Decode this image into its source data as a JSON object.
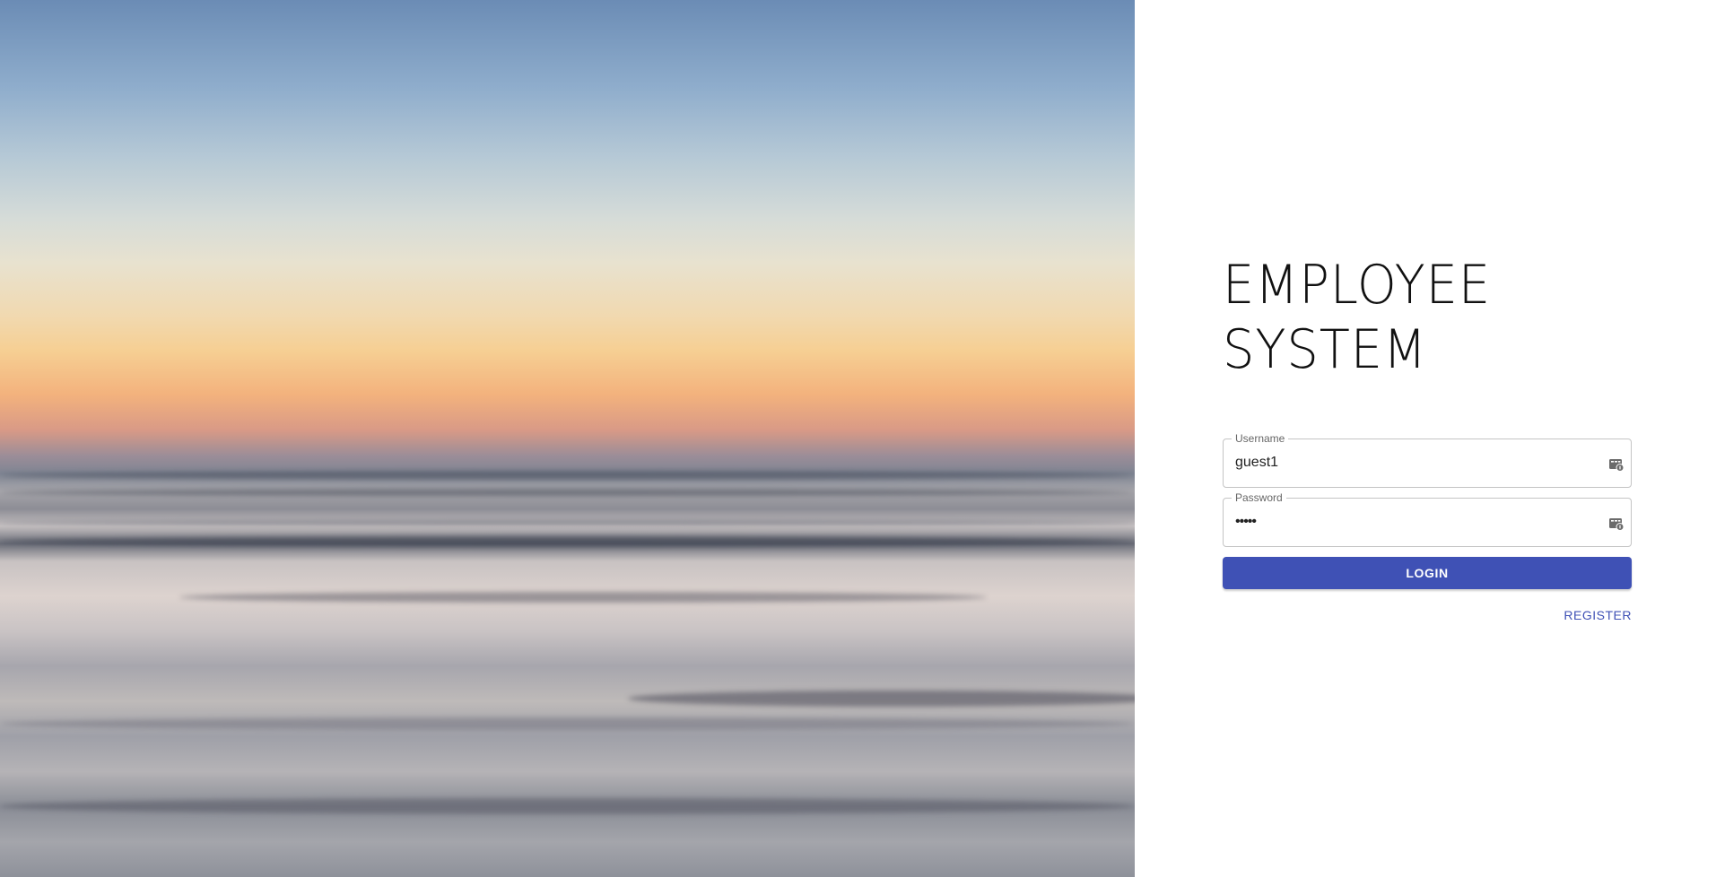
{
  "app": {
    "title_line1": "EMPLOYEE",
    "title_line2": "SYSTEM"
  },
  "login_form": {
    "username": {
      "label": "Username",
      "value": "guest1"
    },
    "password": {
      "label": "Password",
      "value": "•••••"
    },
    "login_label": "LOGIN",
    "register_label": "REGISTER"
  },
  "theme": {
    "accent": "#3f51b5",
    "field_border": "#c4c4c4"
  },
  "icons": {
    "field_autofill": "password-manager-icon"
  }
}
